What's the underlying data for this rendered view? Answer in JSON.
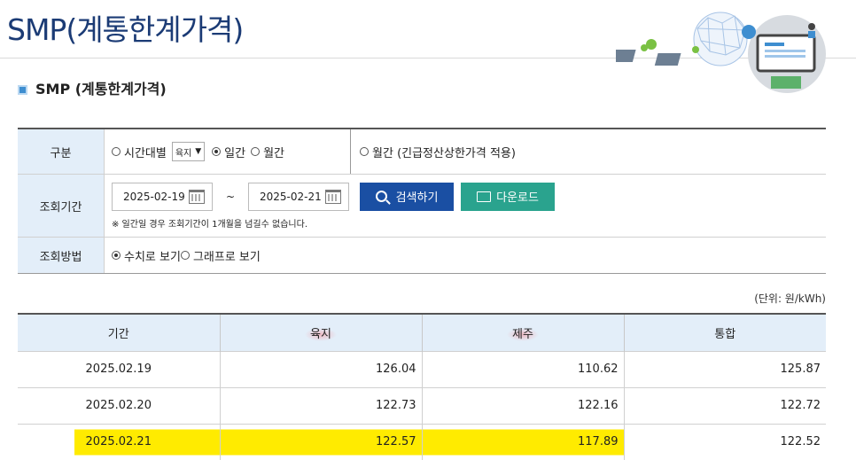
{
  "header": {
    "title": "SMP(계통한계가격)"
  },
  "section": {
    "title": "SMP (계통한계가격)"
  },
  "form": {
    "type_label": "구분",
    "options": {
      "hourly": "시간대별",
      "region_value": "육지",
      "daily": "일간",
      "monthly": "월간",
      "monthly_emergency": "월간 (긴급정산상한가격 적용)"
    },
    "selected_option": "daily",
    "period_label": "조회기간",
    "start_date": "2025-02-19",
    "separator": "~",
    "end_date": "2025-02-21",
    "search_button": "검색하기",
    "download_button": "다운로드",
    "note": "※ 일간일 경우 조회기간이 1개월을 넘길수 없습니다.",
    "method_label": "조회방법",
    "method_options": {
      "numeric": "수치로 보기",
      "graph": "그래프로 보기"
    },
    "selected_method": "numeric"
  },
  "unit": "(단위: 원/kWh)",
  "table": {
    "headers": [
      "기간",
      "육지",
      "제주",
      "통합"
    ],
    "rows": [
      {
        "date": "2025.02.19",
        "mainland": "126.04",
        "jeju": "110.62",
        "total": "125.87"
      },
      {
        "date": "2025.02.20",
        "mainland": "122.73",
        "jeju": "122.16",
        "total": "122.72"
      },
      {
        "date": "2025.02.21",
        "mainland": "122.57",
        "jeju": "117.89",
        "total": "122.52"
      }
    ]
  },
  "colors": {
    "title": "#1b3b75",
    "search_button": "#1a4fa3",
    "download_button": "#2aa38e",
    "label_bg": "#e3eef9",
    "highlight": "#ffeb00"
  }
}
